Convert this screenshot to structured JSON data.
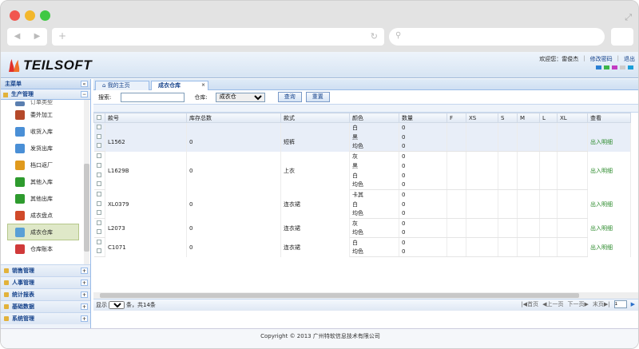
{
  "browser": {
    "url_placeholder": "",
    "search_placeholder": ""
  },
  "header": {
    "logo_text": "TEILSOFT",
    "welcome": "欢迎您：雷俊杰",
    "change_password": "修改密码",
    "logout": "退出",
    "theme_colors": [
      "#2a7fd4",
      "#3cb54a",
      "#c23bc2",
      "#ccc",
      "#1a9fd8"
    ]
  },
  "sidebar": {
    "title": "主菜单",
    "collapse_glyph": "«",
    "section": "生产管理",
    "partial_item": "订单类型",
    "items": [
      {
        "label": "委外加工",
        "color": "#b5492a"
      },
      {
        "label": "收货入库",
        "color": "#4a8fd6"
      },
      {
        "label": "发货出库",
        "color": "#4a8fd6"
      },
      {
        "label": "档口返厂",
        "color": "#e09a1d"
      },
      {
        "label": "其他入库",
        "color": "#2e9b2e"
      },
      {
        "label": "其他出库",
        "color": "#2e9b2e"
      },
      {
        "label": "成衣盘点",
        "color": "#d04a2a"
      },
      {
        "label": "成衣仓库",
        "color": "#5aa0d6",
        "selected": true
      },
      {
        "label": "仓库账本",
        "color": "#d03a3a"
      }
    ],
    "groups": [
      "销售管理",
      "人事管理",
      "统计报表",
      "基础数据",
      "系统管理"
    ]
  },
  "tabs": [
    {
      "label": "我的主页"
    },
    {
      "label": "成衣仓库",
      "active": true
    }
  ],
  "search": {
    "label": "搜索:",
    "warehouse_label": "仓库:",
    "warehouse_value": "成衣仓",
    "query_button": "查询",
    "reset_button": "重置"
  },
  "grid": {
    "headers": [
      "款号",
      "库存总数",
      "款式",
      "颜色",
      "数量",
      "F",
      "XS",
      "S",
      "M",
      "L",
      "XL",
      "查看"
    ],
    "detail_label": "出入明细",
    "blank_row": {
      "color": "白",
      "qty": "0"
    },
    "rows": [
      {
        "code": "L1562",
        "stock": "0",
        "style": "短裤",
        "colors": [
          "黑",
          "均色"
        ],
        "qtys": [
          "0",
          "0"
        ]
      },
      {
        "code": "L1629B",
        "stock": "0",
        "style": "上衣",
        "colors": [
          "灰",
          "黑",
          "白",
          "均色"
        ],
        "qtys": [
          "0",
          "0",
          "0",
          "0"
        ]
      },
      {
        "code": "XL0379",
        "stock": "0",
        "style": "连衣裙",
        "colors": [
          "卡其",
          "白",
          "均色"
        ],
        "qtys": [
          "0",
          "0",
          "0"
        ]
      },
      {
        "code": "L2073",
        "stock": "0",
        "style": "连衣裙",
        "colors": [
          "灰",
          "均色"
        ],
        "qtys": [
          "0",
          "0"
        ]
      },
      {
        "code": "C1071",
        "stock": "0",
        "style": "连衣裙",
        "colors": [
          "白",
          "均色"
        ],
        "qtys": [
          "0",
          "0"
        ]
      }
    ]
  },
  "pager": {
    "show_label": "显示",
    "page_size": "20",
    "summary": "条，共14条",
    "first": "首页",
    "prev": "上一页",
    "next": "下一页",
    "last": "末页",
    "page": "1"
  },
  "footer": {
    "copyright": "Copyright © 2013 广州特软信息技术有限公司"
  }
}
